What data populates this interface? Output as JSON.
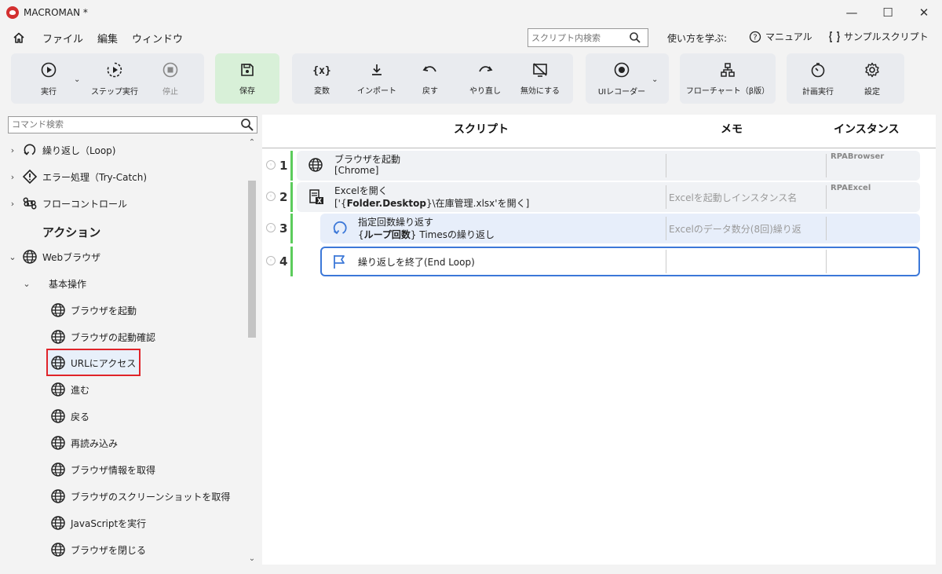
{
  "window": {
    "title": "MACROMAN *",
    "controls": [
      "—",
      "☐",
      "✕"
    ]
  },
  "menu": {
    "items": [
      "ファイル",
      "編集",
      "ウィンドウ"
    ],
    "script_search_placeholder": "スクリプト内検索",
    "help_label": "使い方を学ぶ:",
    "manual": "マニュアル",
    "samples": "サンプルスクリプト"
  },
  "toolbar": {
    "run": "実行",
    "step_run": "ステップ実行",
    "stop": "停止",
    "save": "保存",
    "variables": "変数",
    "import": "インポート",
    "undo": "戻す",
    "redo": "やり直し",
    "disable": "無効にする",
    "ui_recorder": "UIレコーダー",
    "flowchart": "フローチャート（β版）",
    "schedule": "計画実行",
    "settings": "設定"
  },
  "left_panel": {
    "search_placeholder": "コマンド検索",
    "items": [
      {
        "label": "繰り返し（Loop)",
        "chev": "›",
        "icon": "loop-icon"
      },
      {
        "label": "エラー処理（Try-Catch)",
        "chev": "›",
        "icon": "warning-icon"
      },
      {
        "label": "フローコントロール",
        "chev": "›",
        "icon": "command-icon"
      },
      {
        "label": "アクション"
      },
      {
        "label": "Webブラウザ",
        "chev": "⌄",
        "icon": "globe-icon"
      },
      {
        "label": "基本操作",
        "chev": "⌄"
      },
      {
        "label": "ブラウザを起動",
        "icon": "globe-icon"
      },
      {
        "label": "ブラウザの起動確認",
        "icon": "globe-icon"
      },
      {
        "label": "URLにアクセス",
        "icon": "globe-icon",
        "selected": true
      },
      {
        "label": "進む",
        "icon": "globe-icon"
      },
      {
        "label": "戻る",
        "icon": "globe-icon"
      },
      {
        "label": "再読み込み",
        "icon": "globe-icon"
      },
      {
        "label": "ブラウザ情報を取得",
        "icon": "globe-icon"
      },
      {
        "label": "ブラウザのスクリーンショットを取得",
        "icon": "globe-icon"
      },
      {
        "label": "JavaScriptを実行",
        "icon": "globe-icon"
      },
      {
        "label": "ブラウザを閉じる",
        "icon": "globe-icon"
      }
    ]
  },
  "script": {
    "columns": {
      "script": "スクリプト",
      "memo": "メモ",
      "instance": "インスタンス"
    },
    "rows": [
      {
        "num": "1",
        "line1": "ブラウザを起動",
        "line2": "[Chrome]",
        "memo": "",
        "instance": "RPABrowser"
      },
      {
        "num": "2",
        "line1": "Excelを開く",
        "line2_pre": "['{",
        "line2_bold": "Folder.Desktop",
        "line2_post": "}\\在庫管理.xlsx'を開く]",
        "memo": "Excelを起動しインスタンス名",
        "instance": "RPAExcel"
      },
      {
        "num": "3",
        "line1": "指定回数繰り返す",
        "line2_pre": "{",
        "line2_bold": "ループ回数",
        "line2_post": "} Timesの繰り返し",
        "memo": "Excelのデータ数分(8回)繰り返",
        "instance": ""
      },
      {
        "num": "4",
        "line1": "繰り返しを終了(End Loop)",
        "memo": "",
        "instance": ""
      }
    ]
  },
  "colors": {
    "accent_blue": "#3c78d8",
    "selection_red": "#e0242a",
    "step_green": "#5ccc5c",
    "save_bg": "#d8f0d8"
  }
}
